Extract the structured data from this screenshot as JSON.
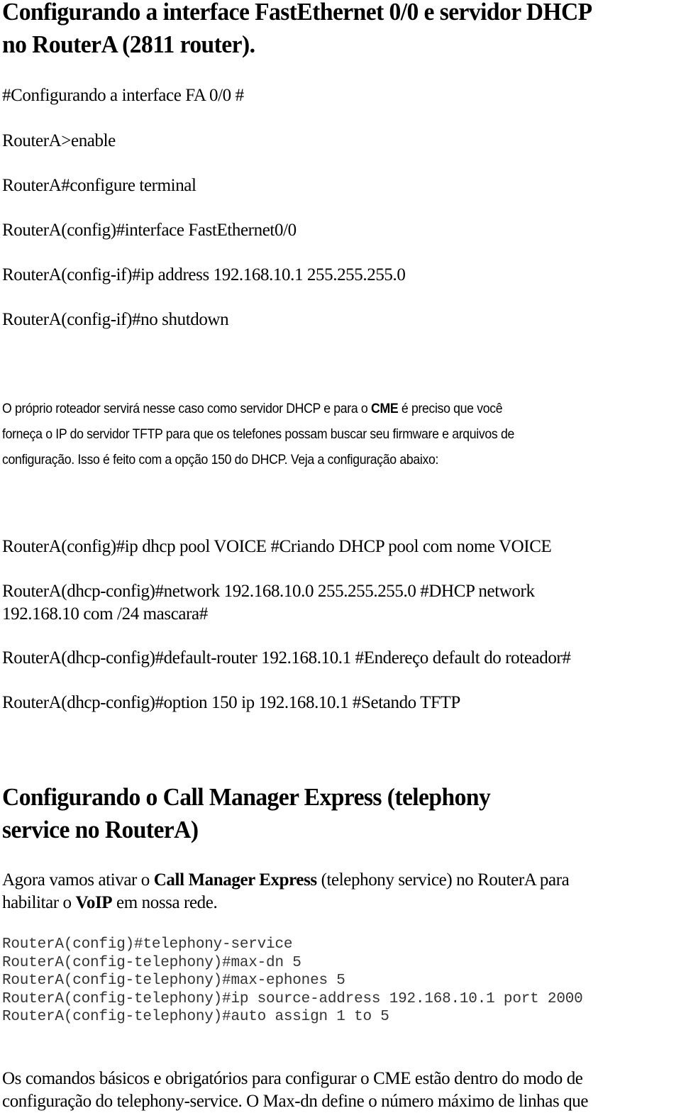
{
  "section1": {
    "heading_line1": "Configurando  a interface FastEthernet 0/0 e servidor DHCP",
    "heading_line2": "no RouterA (2811 router).",
    "commands": [
      "#Configurando a interface FA 0/0 #",
      "RouterA>enable",
      "RouterA#configure terminal",
      "RouterA(config)#interface FastEthernet0/0",
      "RouterA(config-if)#ip address 192.168.10.1 255.255.255.0",
      "RouterA(config-if)#no shutdown"
    ]
  },
  "paragraph1": {
    "line1_before": "O próprio roteador servirá nesse caso como servidor DHCP e para o ",
    "line1_bold": "CME",
    "line1_after": " é preciso que você",
    "line2": "forneça o IP do servidor TFTP para que os telefones possam buscar seu firmware e arquivos de",
    "line3": "configuração. Isso é feito com a opção 150 do DHCP. Veja a configuração abaixo:"
  },
  "dhcp_commands": [
    "RouterA(config)#ip dhcp pool VOICE #Criando DHCP pool com nome VOICE",
    "RouterA(dhcp-config)#network 192.168.10.0 255.255.255.0 #DHCP network",
    "192.168.10 com /24 mascara#",
    "RouterA(dhcp-config)#default-router 192.168.10.1 #Endereço default do roteador#",
    "RouterA(dhcp-config)#option 150 ip 192.168.10.1 #Setando  TFTP"
  ],
  "section2": {
    "heading_line1": "Configurando o Call Manager Express (telephony",
    "heading_line2": "service no RouterA)",
    "intro": {
      "p1": "Agora vamos ativar o ",
      "b1": "Call Manager Express",
      "p2": " (telephony service) no RouterA para",
      "p3": "habilitar o ",
      "b2": "VoIP",
      "p4": " em nossa rede."
    },
    "code": [
      "RouterA(config)#telephony-service",
      "RouterA(config-telephony)#max-dn 5",
      "RouterA(config-telephony)#max-ephones 5",
      "RouterA(config-telephony)#ip source-address 192.168.10.1 port 2000",
      "RouterA(config-telephony)#auto assign 1 to 5"
    ],
    "closing_line1": "Os comandos básicos e obrigatórios para configurar o CME estão dentro do modo de",
    "closing_line2": "configuração do telephony-service. O Max-dn define o número máximo de linhas que"
  }
}
